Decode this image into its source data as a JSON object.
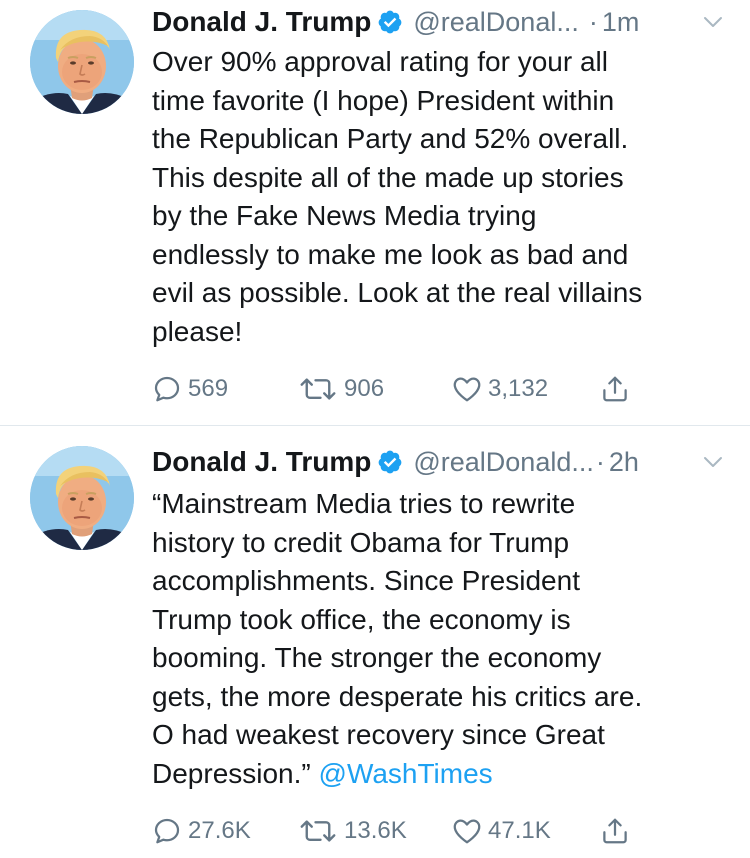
{
  "colors": {
    "link": "#1da1f2",
    "muted": "#657786",
    "text": "#14171a",
    "divider": "#e1e8ed"
  },
  "tweets": [
    {
      "author_name": "Donald J. Trump",
      "handle": "@realDonal...",
      "time": "1m",
      "verified_icon": "verified-badge-icon",
      "avatar_icon": "avatar-photo",
      "body_lines": [
        "Over 90% approval rating for your all",
        "time favorite (I hope) President within",
        "the Republican Party and 52% overall.",
        "This despite all of the made up stories",
        "by the Fake News Media trying",
        "endlessly to make me look as bad and",
        "evil as possible. Look at the real villains",
        "please!"
      ],
      "mention": "",
      "replies": "569",
      "retweets": "906",
      "likes": "3,132"
    },
    {
      "author_name": "Donald J. Trump",
      "handle": "@realDonald...",
      "time": "2h",
      "verified_icon": "verified-badge-icon",
      "avatar_icon": "avatar-photo",
      "body_lines": [
        "“Mainstream Media tries to rewrite",
        "history to credit Obama for Trump",
        "accomplishments. Since President",
        "Trump took office, the economy is",
        "booming. The stronger the economy",
        "gets, the more desperate his critics are.",
        "O had weakest recovery since Great",
        "Depression.”"
      ],
      "mention": "@WashTimes",
      "replies": "27.6K",
      "retweets": "13.6K",
      "likes": "47.1K"
    }
  ]
}
